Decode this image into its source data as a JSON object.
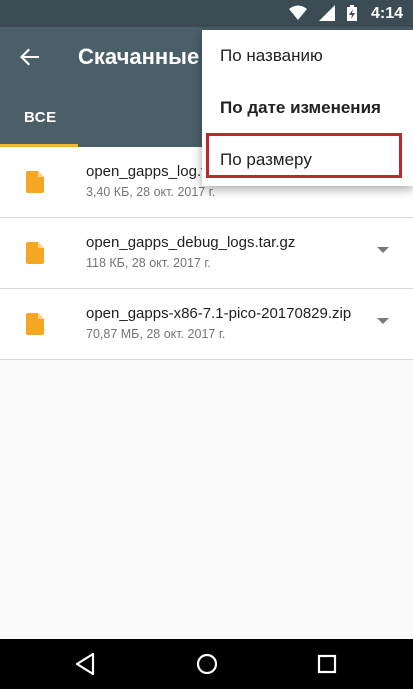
{
  "status_bar": {
    "time": "4:14",
    "icons": [
      "wifi-icon",
      "signal-icon",
      "battery-charging-icon"
    ]
  },
  "app_bar": {
    "title": "Скачанные ф",
    "back_icon": "arrow-left-icon"
  },
  "tabs": [
    {
      "label": "ВСЕ",
      "selected": true
    }
  ],
  "files": [
    {
      "name": "open_gapps_log.txt",
      "meta": "3,40 КБ, 28 окт. 2017 г.",
      "icon": "file-icon",
      "show_chevron": false
    },
    {
      "name": "open_gapps_debug_logs.tar.gz",
      "meta": "118 КБ, 28 окт. 2017 г.",
      "icon": "file-icon",
      "show_chevron": true
    },
    {
      "name": "open_gapps-x86-7.1-pico-20170829.zip",
      "meta": "70,87 МБ, 28 окт. 2017 г.",
      "icon": "file-icon",
      "show_chevron": true
    }
  ],
  "sort_menu": {
    "items": [
      {
        "label": "По названию",
        "selected": false
      },
      {
        "label": "По дате изменения",
        "selected": true
      },
      {
        "label": "По размеру",
        "selected": false
      }
    ],
    "highlighted_item": "По размеру",
    "highlight_color": "#c4262b"
  },
  "nav_bar": {
    "buttons": [
      "back-triangle-icon",
      "home-circle-icon",
      "recents-square-icon"
    ]
  },
  "colors": {
    "app_bar": "#4b5f69",
    "status_bar": "#3b4c55",
    "accent": "#f6b33a",
    "file_icon": "#f5a623"
  }
}
